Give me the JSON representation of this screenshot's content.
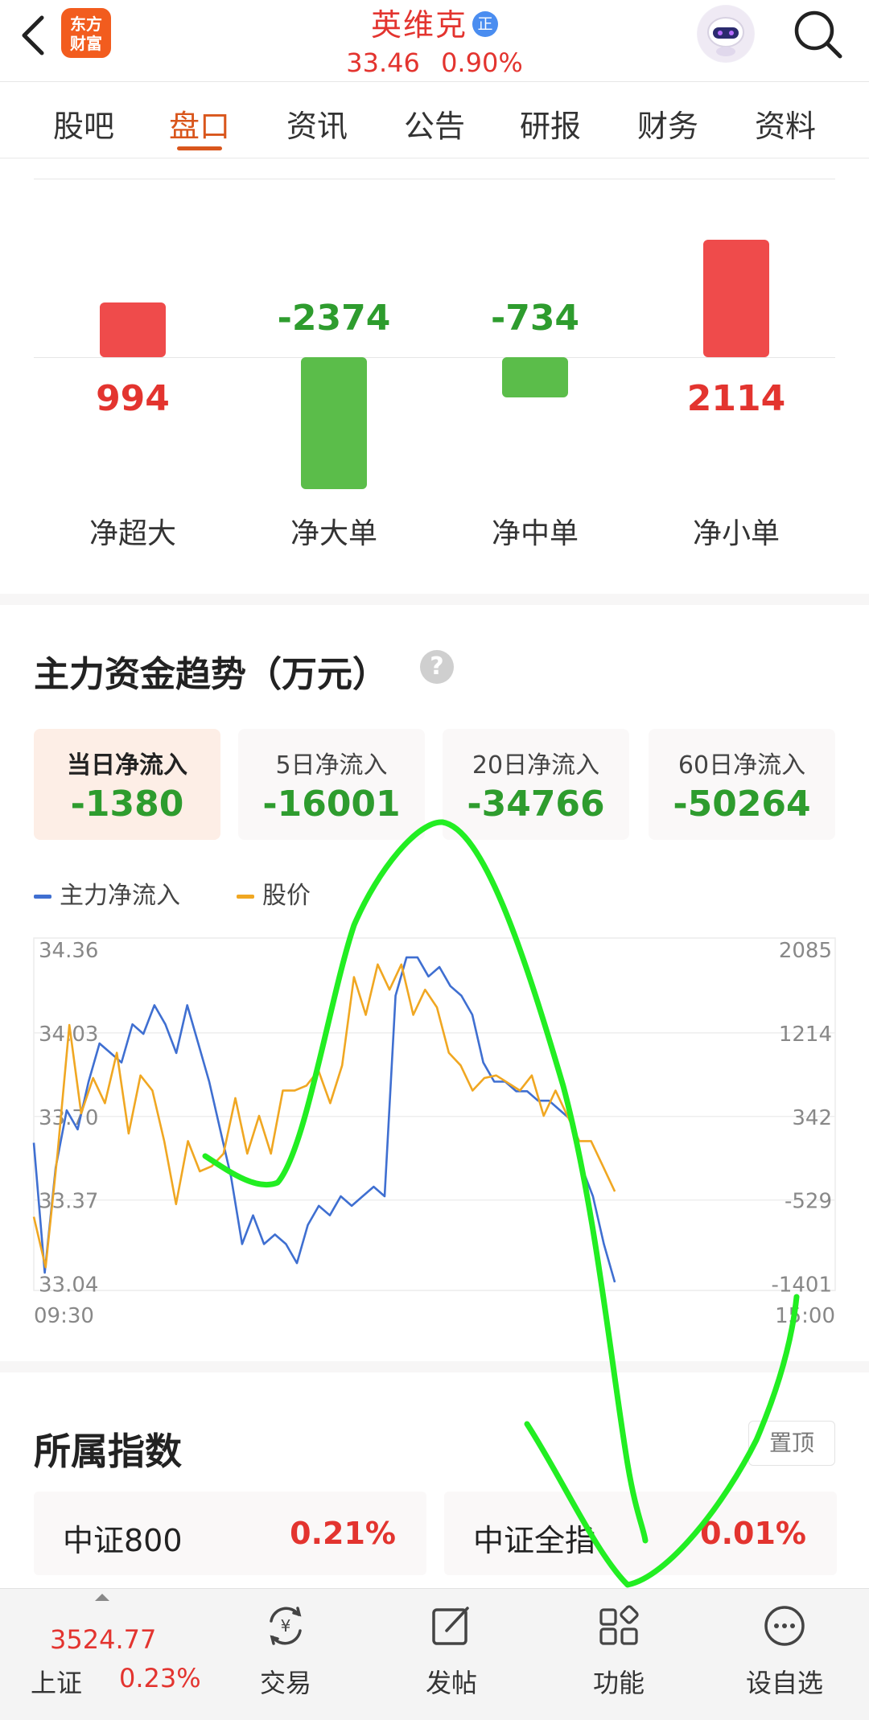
{
  "header": {
    "logo_text_line1": "东方",
    "logo_text_line2": "财富",
    "stock_name": "英维克",
    "badge": "正",
    "price": "33.46",
    "change_pct": "0.90%"
  },
  "tabs": [
    {
      "label": "股吧"
    },
    {
      "label": "盘口"
    },
    {
      "label": "资讯"
    },
    {
      "label": "公告"
    },
    {
      "label": "研报"
    },
    {
      "label": "财务"
    },
    {
      "label": "资料"
    }
  ],
  "active_tab": "盘口",
  "fund_flow": {
    "items": [
      {
        "label": "净超大",
        "value": "994"
      },
      {
        "label": "净大单",
        "value": "-2374"
      },
      {
        "label": "净中单",
        "value": "-734"
      },
      {
        "label": "净小单",
        "value": "2114"
      }
    ]
  },
  "trend": {
    "title": "主力资金趋势（万元）",
    "help": "?",
    "periods": [
      {
        "label": "当日净流入",
        "value": "-1380"
      },
      {
        "label": "5日净流入",
        "value": "-16001"
      },
      {
        "label": "20日净流入",
        "value": "-34766"
      },
      {
        "label": "60日净流入",
        "value": "-50264"
      }
    ],
    "legend": [
      {
        "name": "主力净流入",
        "color": "#3f6fd1"
      },
      {
        "name": "股价",
        "color": "#f0a722"
      }
    ]
  },
  "chart_data": {
    "type": "line",
    "left_axis_ticks": [
      "34.36",
      "34.03",
      "33.70",
      "33.37",
      "33.04"
    ],
    "right_axis_ticks": [
      "2085",
      "1214",
      "342",
      "-529",
      "-1401"
    ],
    "x_ticks": [
      "09:30",
      "15:00"
    ],
    "ylim_left": [
      33.04,
      34.36
    ],
    "ylim_right": [
      -1401,
      2085
    ],
    "series": [
      {
        "name": "主力净流入",
        "color": "#3f6fd1",
        "axis": "right",
        "values": [
          60,
          -1300,
          -200,
          400,
          200,
          700,
          1100,
          1000,
          900,
          1300,
          1200,
          1500,
          1300,
          1000,
          1500,
          1100,
          700,
          200,
          -300,
          -1000,
          -700,
          -1000,
          -900,
          -1000,
          -1200,
          -800,
          -600,
          -700,
          -500,
          -600,
          -500,
          -400,
          -500,
          1600,
          2000,
          2000,
          1800,
          1900,
          1700,
          1600,
          1400,
          900,
          700,
          700,
          600,
          600,
          500,
          500,
          400,
          300,
          -200,
          -500,
          -1000,
          -1400
        ]
      },
      {
        "name": "股价",
        "color": "#f0a722",
        "axis": "left",
        "values": [
          33.3,
          33.1,
          33.55,
          34.06,
          33.71,
          33.85,
          33.75,
          33.95,
          33.63,
          33.86,
          33.8,
          33.6,
          33.35,
          33.6,
          33.48,
          33.5,
          33.55,
          33.77,
          33.55,
          33.7,
          33.55,
          33.8,
          33.8,
          33.82,
          33.88,
          33.75,
          33.9,
          34.25,
          34.1,
          34.3,
          34.2,
          34.3,
          34.1,
          34.2,
          34.13,
          33.95,
          33.9,
          33.8,
          33.85,
          33.86,
          33.83,
          33.8,
          33.86,
          33.7,
          33.8,
          33.7,
          33.6,
          33.6,
          33.5,
          33.4
        ]
      }
    ]
  },
  "indices": {
    "title": "所属指数",
    "pin_label": "置顶",
    "items": [
      {
        "name": "中证800",
        "pct": "0.21%"
      },
      {
        "name": "中证全指",
        "pct": "0.01%"
      }
    ]
  },
  "bottom_bar": {
    "market_price": "3524.77",
    "market_name": "上证",
    "market_pct": "0.23%",
    "nav": [
      {
        "label": "交易"
      },
      {
        "label": "发帖"
      },
      {
        "label": "功能"
      },
      {
        "label": "设自选"
      }
    ]
  },
  "colors": {
    "up": "#e3342f",
    "down": "#2e9c2e",
    "bar_up": "#ef4b4b",
    "bar_down": "#5bbd4a",
    "accent": "#d9561c",
    "annotation": "#22ee22"
  }
}
